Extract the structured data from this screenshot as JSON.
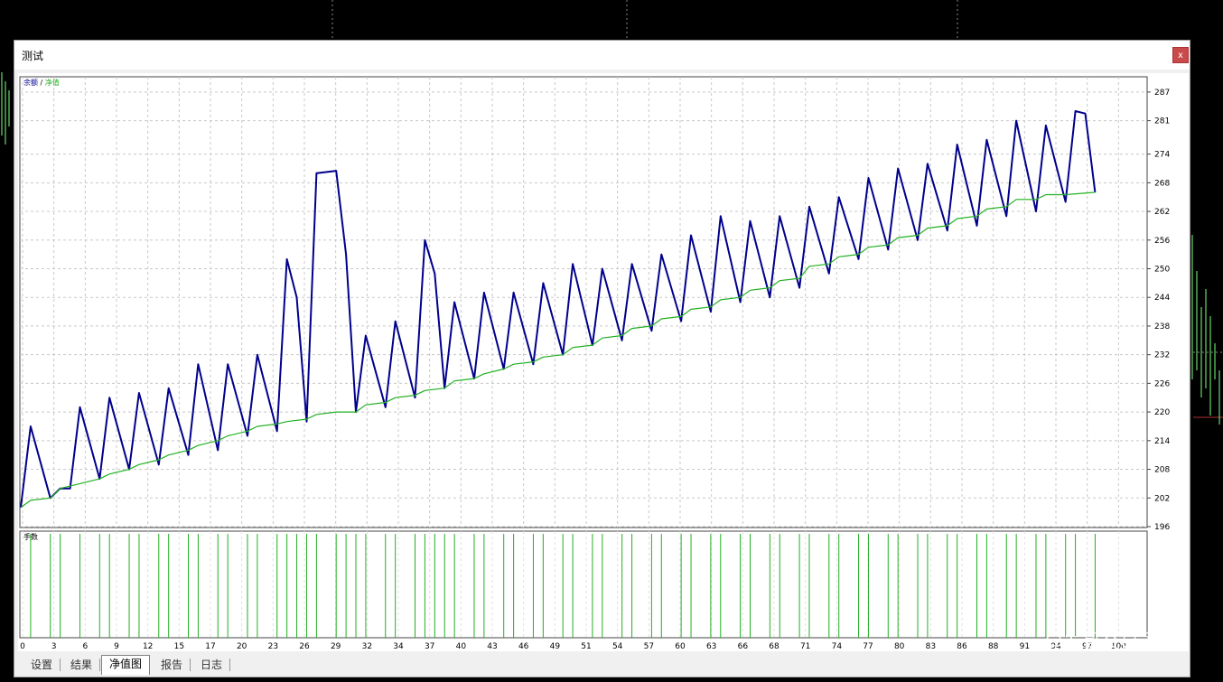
{
  "window": {
    "title": "测试",
    "close_label": "x"
  },
  "tabs": [
    {
      "label": "设置",
      "active": false
    },
    {
      "label": "结果",
      "active": false
    },
    {
      "label": "净值图",
      "active": true
    },
    {
      "label": "报告",
      "active": false
    },
    {
      "label": "日志",
      "active": false
    }
  ],
  "watermark": "@发哥交易员",
  "colors": {
    "balance": "#00008b",
    "equity": "#22b022",
    "volume": "#22b022",
    "background_chart": "#80ff80"
  },
  "chart_data": {
    "type": "line",
    "legend": [
      "余额",
      "净值"
    ],
    "legend_separator": "/",
    "ylim": [
      196,
      290
    ],
    "yticks": [
      196,
      202,
      208,
      214,
      220,
      226,
      232,
      238,
      244,
      250,
      256,
      262,
      268,
      274,
      281,
      287
    ],
    "xticks": [
      "0",
      "3",
      "6",
      "9",
      "12",
      "15",
      "17",
      "20",
      "23",
      "26",
      "29",
      "32",
      "34",
      "37",
      "40",
      "43",
      "46",
      "49",
      "51",
      "54",
      "57",
      "60",
      "63",
      "66",
      "68",
      "71",
      "74",
      "77",
      "80",
      "83",
      "86",
      "88",
      "91",
      "94",
      "97",
      "100"
    ],
    "x_max": 114,
    "series": [
      {
        "name": "余额",
        "points": [
          [
            0,
            200
          ],
          [
            1,
            217
          ],
          [
            3,
            202
          ],
          [
            4,
            204
          ],
          [
            5,
            204
          ],
          [
            6,
            221
          ],
          [
            8,
            206
          ],
          [
            9,
            223
          ],
          [
            11,
            208
          ],
          [
            12,
            224
          ],
          [
            14,
            209
          ],
          [
            15,
            225
          ],
          [
            17,
            211
          ],
          [
            18,
            230
          ],
          [
            20,
            212
          ],
          [
            21,
            230
          ],
          [
            23,
            215
          ],
          [
            24,
            232
          ],
          [
            26,
            216
          ],
          [
            27,
            252
          ],
          [
            28,
            244
          ],
          [
            29,
            218
          ],
          [
            30,
            270
          ],
          [
            32,
            270.5
          ],
          [
            33,
            253
          ],
          [
            34,
            220
          ],
          [
            35,
            236
          ],
          [
            37,
            221
          ],
          [
            38,
            239
          ],
          [
            40,
            223
          ],
          [
            41,
            256
          ],
          [
            42,
            249
          ],
          [
            43,
            225
          ],
          [
            44,
            243
          ],
          [
            46,
            227
          ],
          [
            47,
            245
          ],
          [
            49,
            229
          ],
          [
            50,
            245
          ],
          [
            52,
            230
          ],
          [
            53,
            247
          ],
          [
            55,
            232
          ],
          [
            56,
            251
          ],
          [
            58,
            234
          ],
          [
            59,
            250
          ],
          [
            61,
            235
          ],
          [
            62,
            251
          ],
          [
            64,
            237
          ],
          [
            65,
            253
          ],
          [
            67,
            239
          ],
          [
            68,
            257
          ],
          [
            70,
            241
          ],
          [
            71,
            261
          ],
          [
            73,
            243
          ],
          [
            74,
            260
          ],
          [
            76,
            244
          ],
          [
            77,
            261
          ],
          [
            79,
            246
          ],
          [
            80,
            263
          ],
          [
            82,
            249
          ],
          [
            83,
            265
          ],
          [
            85,
            252
          ],
          [
            86,
            269
          ],
          [
            88,
            254
          ],
          [
            89,
            271
          ],
          [
            91,
            256
          ],
          [
            92,
            272
          ],
          [
            94,
            258
          ],
          [
            95,
            276
          ],
          [
            97,
            259
          ],
          [
            98,
            277
          ],
          [
            100,
            261
          ],
          [
            101,
            281
          ],
          [
            103,
            262
          ],
          [
            104,
            280
          ],
          [
            106,
            264
          ],
          [
            107,
            283
          ],
          [
            108,
            282.5
          ],
          [
            109,
            266
          ]
        ]
      },
      {
        "name": "净值",
        "points": [
          [
            0,
            200
          ],
          [
            1,
            201.5
          ],
          [
            3,
            202
          ],
          [
            4,
            204
          ],
          [
            6,
            205
          ],
          [
            8,
            206
          ],
          [
            9,
            207
          ],
          [
            11,
            208
          ],
          [
            12,
            209
          ],
          [
            14,
            210
          ],
          [
            15,
            211
          ],
          [
            17,
            212
          ],
          [
            18,
            213
          ],
          [
            20,
            214
          ],
          [
            21,
            215
          ],
          [
            23,
            216
          ],
          [
            24,
            217
          ],
          [
            26,
            217.5
          ],
          [
            27,
            218
          ],
          [
            29,
            218.5
          ],
          [
            30,
            219.5
          ],
          [
            32,
            220
          ],
          [
            34,
            220
          ],
          [
            35,
            221.5
          ],
          [
            37,
            222
          ],
          [
            38,
            223
          ],
          [
            40,
            223.5
          ],
          [
            41,
            224.5
          ],
          [
            43,
            225
          ],
          [
            44,
            226.5
          ],
          [
            46,
            227
          ],
          [
            47,
            228
          ],
          [
            49,
            229
          ],
          [
            50,
            230
          ],
          [
            52,
            230.5
          ],
          [
            53,
            231.5
          ],
          [
            55,
            232
          ],
          [
            56,
            233.5
          ],
          [
            58,
            234
          ],
          [
            59,
            235.5
          ],
          [
            61,
            236
          ],
          [
            62,
            237.5
          ],
          [
            64,
            238
          ],
          [
            65,
            239.5
          ],
          [
            67,
            240
          ],
          [
            68,
            241.5
          ],
          [
            70,
            242
          ],
          [
            71,
            243.5
          ],
          [
            73,
            244
          ],
          [
            74,
            245.5
          ],
          [
            76,
            246
          ],
          [
            77,
            247.5
          ],
          [
            79,
            248
          ],
          [
            80,
            250.5
          ],
          [
            82,
            251
          ],
          [
            83,
            252.5
          ],
          [
            85,
            253
          ],
          [
            86,
            254.5
          ],
          [
            88,
            255
          ],
          [
            89,
            256.5
          ],
          [
            91,
            257
          ],
          [
            92,
            258.5
          ],
          [
            94,
            259
          ],
          [
            95,
            260.5
          ],
          [
            97,
            261
          ],
          [
            98,
            262.5
          ],
          [
            100,
            263
          ],
          [
            101,
            264.5
          ],
          [
            103,
            264.5
          ],
          [
            104,
            265.5
          ],
          [
            106,
            265.5
          ],
          [
            109,
            266
          ]
        ]
      }
    ],
    "volume_label": "手数",
    "volume_x": [
      1,
      3,
      4,
      6,
      8,
      9,
      11,
      12,
      14,
      15,
      17,
      18,
      20,
      21,
      23,
      24,
      26,
      27,
      28,
      29,
      30,
      32,
      33,
      34,
      35,
      37,
      38,
      40,
      41,
      42,
      43,
      44,
      46,
      47,
      49,
      50,
      52,
      53,
      55,
      56,
      58,
      59,
      61,
      62,
      64,
      65,
      67,
      68,
      70,
      71,
      73,
      74,
      76,
      77,
      79,
      80,
      82,
      83,
      85,
      86,
      88,
      89,
      91,
      92,
      94,
      95,
      97,
      98,
      100,
      101,
      103,
      104,
      106,
      107,
      109
    ]
  }
}
